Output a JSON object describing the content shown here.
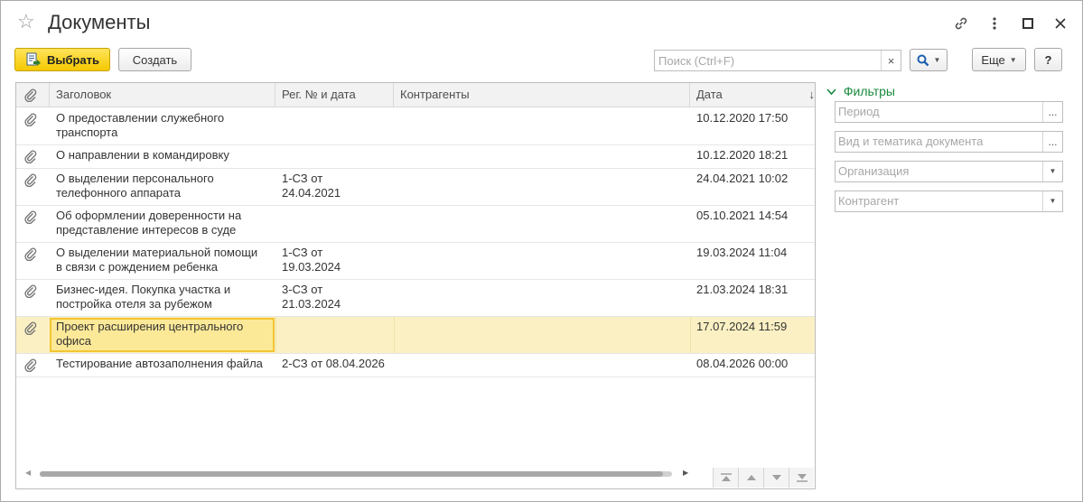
{
  "window": {
    "title": "Документы"
  },
  "toolbar": {
    "select_label": "Выбрать",
    "create_label": "Создать",
    "search_placeholder": "Поиск (Ctrl+F)",
    "clear_symbol": "×",
    "more_label": "Еще",
    "help_label": "?"
  },
  "table": {
    "columns": [
      "Заголовок",
      "Рег. № и дата",
      "Контрагенты",
      "Дата"
    ],
    "rows": [
      {
        "title": [
          "О предоставлении служебного",
          "транспорта"
        ],
        "reg": [
          "",
          ""
        ],
        "counterparty": "",
        "date": "10.12.2020 17:50"
      },
      {
        "title": [
          "О направлении в командировку",
          ""
        ],
        "reg": [
          "",
          ""
        ],
        "counterparty": "",
        "date": "10.12.2020 18:21"
      },
      {
        "title": [
          "О выделении персонального",
          "телефонного аппарата"
        ],
        "reg": [
          "1-СЗ от",
          "24.04.2021"
        ],
        "counterparty": "",
        "date": "24.04.2021 10:02"
      },
      {
        "title": [
          "Об оформлении доверенности на",
          "представление интересов в суде"
        ],
        "reg": [
          "",
          ""
        ],
        "counterparty": "",
        "date": "05.10.2021 14:54"
      },
      {
        "title": [
          "О выделении материальной помощи",
          "в связи с рождением ребенка"
        ],
        "reg": [
          "1-СЗ от",
          "19.03.2024"
        ],
        "counterparty": "",
        "date": "19.03.2024 11:04"
      },
      {
        "title": [
          "Бизнес-идея. Покупка участка и",
          "постройка отеля за рубежом"
        ],
        "reg": [
          "3-СЗ от",
          "21.03.2024"
        ],
        "counterparty": "",
        "date": "21.03.2024 18:31"
      },
      {
        "title": [
          "Проект расширения центрального",
          "офиса"
        ],
        "reg": [
          "",
          ""
        ],
        "counterparty": "",
        "date": "17.07.2024 11:59",
        "selected": true
      },
      {
        "title": [
          "Тестирование автозаполнения файла",
          ""
        ],
        "reg": [
          "2-СЗ от 08.04.2026",
          ""
        ],
        "counterparty": "",
        "date": "08.04.2026 00:00"
      }
    ]
  },
  "filters": {
    "title": "Фильтры",
    "period_placeholder": "Период",
    "doc_type_placeholder": "Вид и тематика документа",
    "org_placeholder": "Организация",
    "counterparty_placeholder": "Контрагент",
    "more_symbol": "..."
  },
  "colors": {
    "accent_green": "#1a8a3c",
    "primary_yellow": "#f5c800",
    "selected_row": "#fbf0c3"
  }
}
